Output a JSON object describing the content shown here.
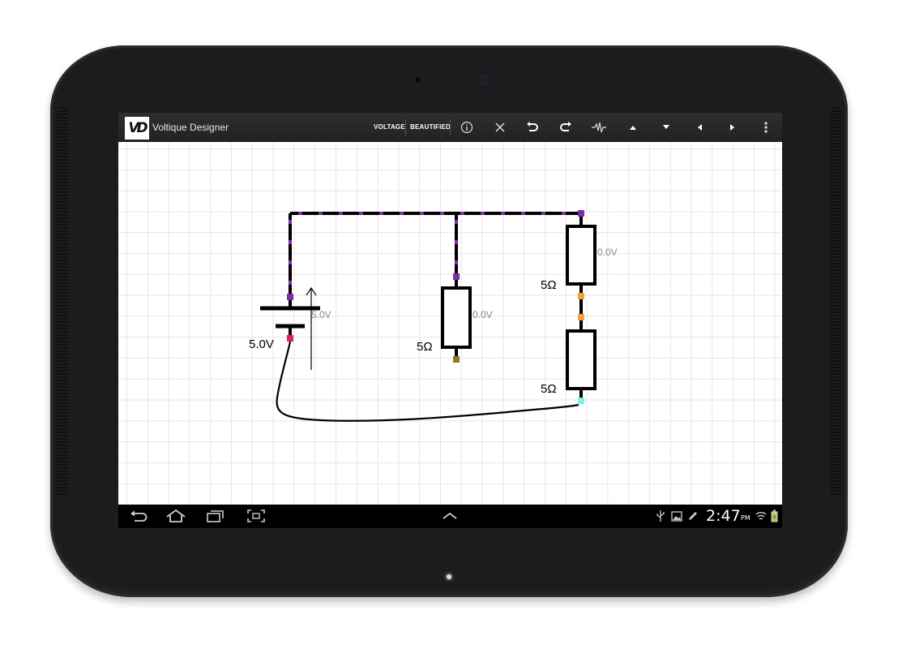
{
  "app": {
    "title": "Voltique Designer",
    "logo_text": "VD"
  },
  "toolbar": {
    "voltage_label": "VOLTAGE",
    "beautified_label": "BEAUTIFIED",
    "icons": [
      "info-icon",
      "close-icon",
      "undo-icon",
      "redo-icon",
      "waveform-icon",
      "arrow-up-icon",
      "arrow-down-icon",
      "arrow-left-icon",
      "arrow-right-icon",
      "overflow-menu-icon"
    ]
  },
  "circuit": {
    "battery": {
      "voltage_label": "5.0V",
      "reading": "5.0V"
    },
    "resistor_middle": {
      "resistance_label": "5Ω",
      "reading": "0.0V"
    },
    "resistor_right_top": {
      "resistance_label": "5Ω",
      "reading": "0.0V"
    },
    "resistor_right_bottom": {
      "resistance_label": "5Ω"
    }
  },
  "colors": {
    "wire": "#000000",
    "node_purple": "#7b2fa3",
    "node_pink": "#e0206a",
    "node_olive": "#8c7a1e",
    "node_orange": "#f0a040",
    "node_cyan": "#7ff0e8",
    "reading_gray": "#8a8a8a"
  },
  "navbar": {
    "icons": [
      "back-icon",
      "home-icon",
      "recent-apps-icon",
      "screenshot-icon",
      "up-chevron-icon"
    ],
    "status_icons": [
      "usb-icon",
      "gallery-icon",
      "pen-icon",
      "wifi-icon",
      "battery-icon"
    ],
    "time": "2:47",
    "ampm": "PM"
  }
}
